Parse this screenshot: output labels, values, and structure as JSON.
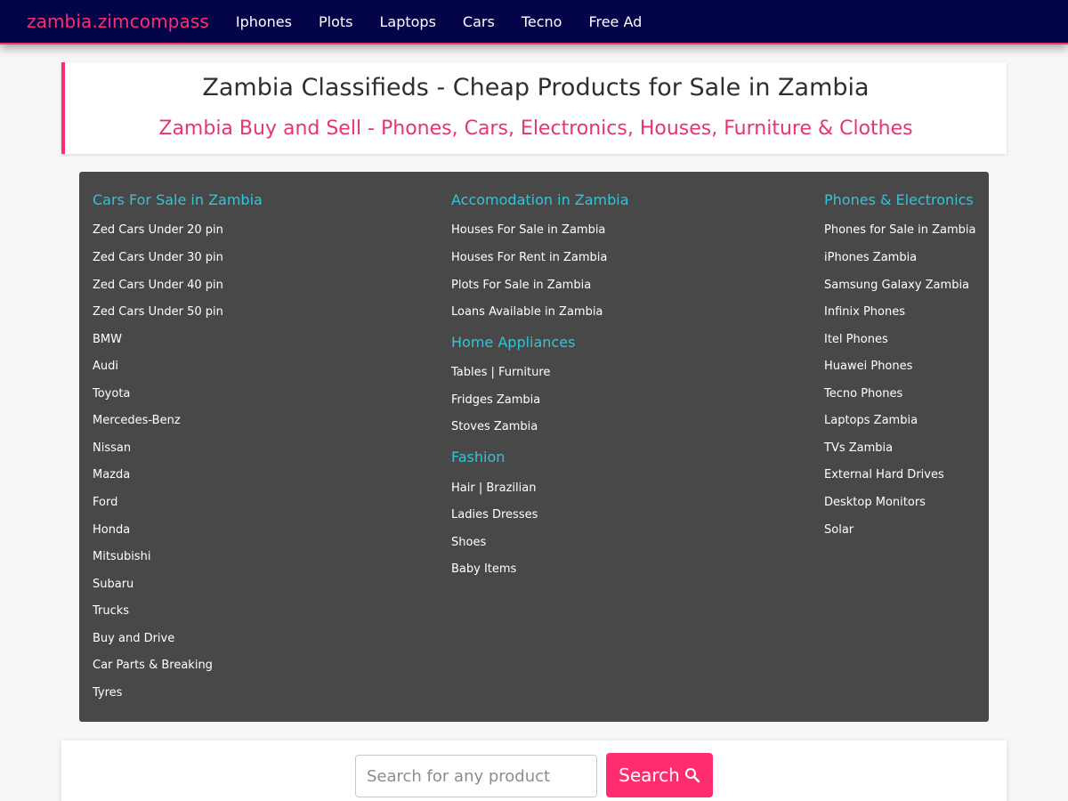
{
  "navbar": {
    "brand": "zambia.zimcompass",
    "links": [
      "Iphones",
      "Plots",
      "Laptops",
      "Cars",
      "Tecno",
      "Free Ad"
    ]
  },
  "header": {
    "title": "Zambia Classifieds - Cheap Products for Sale in Zambia",
    "subtitle": "Zambia Buy and Sell - Phones, Cars, Electronics, Houses, Furniture & Clothes"
  },
  "categories": {
    "cars": {
      "heading": "Cars For Sale in Zambia",
      "links": [
        "Zed Cars Under 20 pin",
        "Zed Cars Under 30 pin",
        "Zed Cars Under 40 pin",
        "Zed Cars Under 50 pin",
        "BMW",
        "Audi",
        "Toyota",
        "Mercedes-Benz",
        "Nissan",
        "Mazda",
        "Ford",
        "Honda",
        "Mitsubishi",
        "Subaru",
        "Trucks",
        "Buy and Drive",
        "Car Parts & Breaking",
        "Tyres"
      ]
    },
    "accomodation": {
      "heading": "Accomodation in Zambia",
      "links": [
        "Houses For Sale in Zambia",
        "Houses For Rent in Zambia",
        "Plots For Sale in Zambia",
        "Loans Available in Zambia"
      ]
    },
    "appliances": {
      "heading": "Home Appliances",
      "links": [
        "Tables | Furniture",
        "Fridges Zambia",
        "Stoves Zambia"
      ]
    },
    "fashion": {
      "heading": "Fashion",
      "links": [
        "Hair | Brazilian",
        "Ladies Dresses",
        "Shoes",
        "Baby Items"
      ]
    },
    "phones": {
      "heading": "Phones & Electronics",
      "links": [
        "Phones for Sale in Zambia",
        "iPhones Zambia",
        "Samsung Galaxy Zambia",
        "Infinix Phones",
        "Itel Phones",
        "Huawei Phones",
        "Tecno Phones",
        "Laptops Zambia",
        "TVs Zambia",
        "External Hard Drives",
        "Desktop Monitors",
        "Solar"
      ]
    }
  },
  "search": {
    "placeholder": "Search for any product",
    "button_label": "Search",
    "button_icon": "search-icon"
  },
  "colors": {
    "navbar_bg": "#040448",
    "accent": "#ff2d6f",
    "heading_cyan": "#33c4d8",
    "panel_bg": "#484848"
  }
}
